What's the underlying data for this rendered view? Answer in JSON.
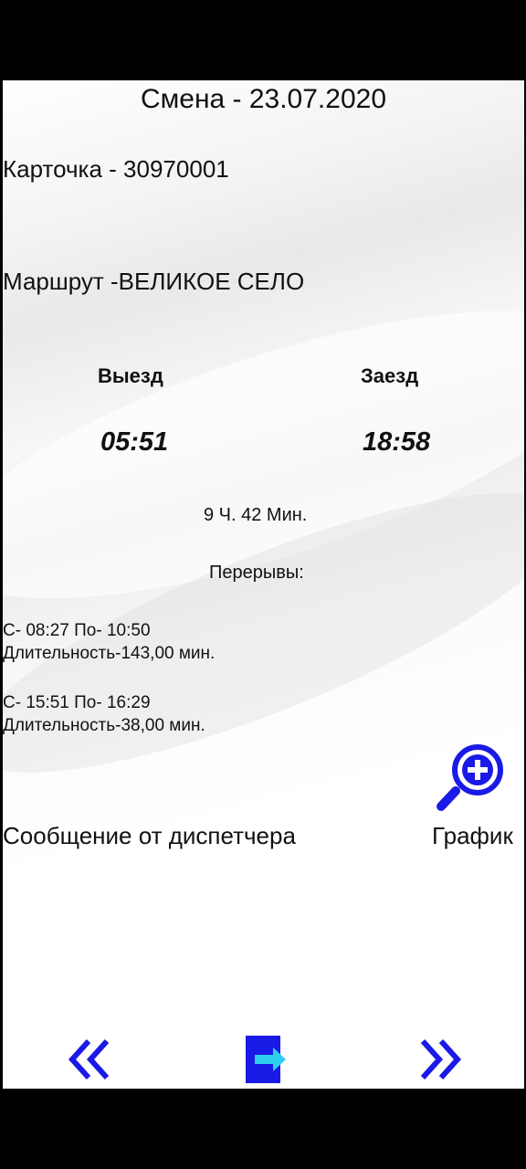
{
  "header": {
    "shift": "Смена - 23.07.2020"
  },
  "card": "Карточка -  30970001",
  "route": "Маршрут -ВЕЛИКОЕ СЕЛО",
  "schedule": {
    "departure_label": "Выезд",
    "arrival_label": "Заезд",
    "departure_time": "05:51",
    "arrival_time": "18:58",
    "duration": "9 Ч.  42 Мин."
  },
  "breaks": {
    "label": "Перерывы:",
    "items": [
      {
        "range": "С- 08:27  По- 10:50",
        "length": "Длительность-143,00 мин."
      },
      {
        "range": "С- 15:51  По- 16:29",
        "length": "Длительность-38,00 мин."
      }
    ]
  },
  "actions": {
    "dispatcher_message": "Сообщение от диспетчера",
    "schedule_label": "График"
  },
  "icons": {
    "zoom": "zoom-in-magnifier-icon",
    "prev": "double-chevron-left-icon",
    "exit": "exit-door-icon",
    "next": "double-chevron-right-icon"
  },
  "colors": {
    "accent": "#1a1ae6",
    "exit_arrow": "#2ed0f0"
  }
}
